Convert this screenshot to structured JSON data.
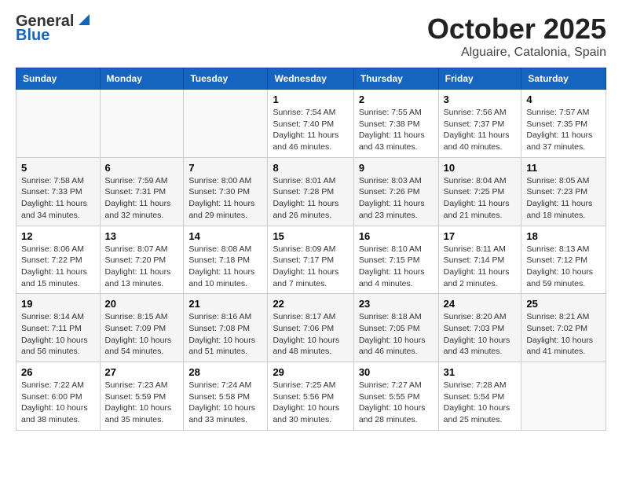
{
  "logo": {
    "general": "General",
    "blue": "Blue"
  },
  "header": {
    "title": "October 2025",
    "subtitle": "Alguaire, Catalonia, Spain"
  },
  "days_of_week": [
    "Sunday",
    "Monday",
    "Tuesday",
    "Wednesday",
    "Thursday",
    "Friday",
    "Saturday"
  ],
  "weeks": [
    [
      {
        "day": "",
        "info": ""
      },
      {
        "day": "",
        "info": ""
      },
      {
        "day": "",
        "info": ""
      },
      {
        "day": "1",
        "info": "Sunrise: 7:54 AM\nSunset: 7:40 PM\nDaylight: 11 hours and 46 minutes."
      },
      {
        "day": "2",
        "info": "Sunrise: 7:55 AM\nSunset: 7:38 PM\nDaylight: 11 hours and 43 minutes."
      },
      {
        "day": "3",
        "info": "Sunrise: 7:56 AM\nSunset: 7:37 PM\nDaylight: 11 hours and 40 minutes."
      },
      {
        "day": "4",
        "info": "Sunrise: 7:57 AM\nSunset: 7:35 PM\nDaylight: 11 hours and 37 minutes."
      }
    ],
    [
      {
        "day": "5",
        "info": "Sunrise: 7:58 AM\nSunset: 7:33 PM\nDaylight: 11 hours and 34 minutes."
      },
      {
        "day": "6",
        "info": "Sunrise: 7:59 AM\nSunset: 7:31 PM\nDaylight: 11 hours and 32 minutes."
      },
      {
        "day": "7",
        "info": "Sunrise: 8:00 AM\nSunset: 7:30 PM\nDaylight: 11 hours and 29 minutes."
      },
      {
        "day": "8",
        "info": "Sunrise: 8:01 AM\nSunset: 7:28 PM\nDaylight: 11 hours and 26 minutes."
      },
      {
        "day": "9",
        "info": "Sunrise: 8:03 AM\nSunset: 7:26 PM\nDaylight: 11 hours and 23 minutes."
      },
      {
        "day": "10",
        "info": "Sunrise: 8:04 AM\nSunset: 7:25 PM\nDaylight: 11 hours and 21 minutes."
      },
      {
        "day": "11",
        "info": "Sunrise: 8:05 AM\nSunset: 7:23 PM\nDaylight: 11 hours and 18 minutes."
      }
    ],
    [
      {
        "day": "12",
        "info": "Sunrise: 8:06 AM\nSunset: 7:22 PM\nDaylight: 11 hours and 15 minutes."
      },
      {
        "day": "13",
        "info": "Sunrise: 8:07 AM\nSunset: 7:20 PM\nDaylight: 11 hours and 13 minutes."
      },
      {
        "day": "14",
        "info": "Sunrise: 8:08 AM\nSunset: 7:18 PM\nDaylight: 11 hours and 10 minutes."
      },
      {
        "day": "15",
        "info": "Sunrise: 8:09 AM\nSunset: 7:17 PM\nDaylight: 11 hours and 7 minutes."
      },
      {
        "day": "16",
        "info": "Sunrise: 8:10 AM\nSunset: 7:15 PM\nDaylight: 11 hours and 4 minutes."
      },
      {
        "day": "17",
        "info": "Sunrise: 8:11 AM\nSunset: 7:14 PM\nDaylight: 11 hours and 2 minutes."
      },
      {
        "day": "18",
        "info": "Sunrise: 8:13 AM\nSunset: 7:12 PM\nDaylight: 10 hours and 59 minutes."
      }
    ],
    [
      {
        "day": "19",
        "info": "Sunrise: 8:14 AM\nSunset: 7:11 PM\nDaylight: 10 hours and 56 minutes."
      },
      {
        "day": "20",
        "info": "Sunrise: 8:15 AM\nSunset: 7:09 PM\nDaylight: 10 hours and 54 minutes."
      },
      {
        "day": "21",
        "info": "Sunrise: 8:16 AM\nSunset: 7:08 PM\nDaylight: 10 hours and 51 minutes."
      },
      {
        "day": "22",
        "info": "Sunrise: 8:17 AM\nSunset: 7:06 PM\nDaylight: 10 hours and 48 minutes."
      },
      {
        "day": "23",
        "info": "Sunrise: 8:18 AM\nSunset: 7:05 PM\nDaylight: 10 hours and 46 minutes."
      },
      {
        "day": "24",
        "info": "Sunrise: 8:20 AM\nSunset: 7:03 PM\nDaylight: 10 hours and 43 minutes."
      },
      {
        "day": "25",
        "info": "Sunrise: 8:21 AM\nSunset: 7:02 PM\nDaylight: 10 hours and 41 minutes."
      }
    ],
    [
      {
        "day": "26",
        "info": "Sunrise: 7:22 AM\nSunset: 6:00 PM\nDaylight: 10 hours and 38 minutes."
      },
      {
        "day": "27",
        "info": "Sunrise: 7:23 AM\nSunset: 5:59 PM\nDaylight: 10 hours and 35 minutes."
      },
      {
        "day": "28",
        "info": "Sunrise: 7:24 AM\nSunset: 5:58 PM\nDaylight: 10 hours and 33 minutes."
      },
      {
        "day": "29",
        "info": "Sunrise: 7:25 AM\nSunset: 5:56 PM\nDaylight: 10 hours and 30 minutes."
      },
      {
        "day": "30",
        "info": "Sunrise: 7:27 AM\nSunset: 5:55 PM\nDaylight: 10 hours and 28 minutes."
      },
      {
        "day": "31",
        "info": "Sunrise: 7:28 AM\nSunset: 5:54 PM\nDaylight: 10 hours and 25 minutes."
      },
      {
        "day": "",
        "info": ""
      }
    ]
  ]
}
